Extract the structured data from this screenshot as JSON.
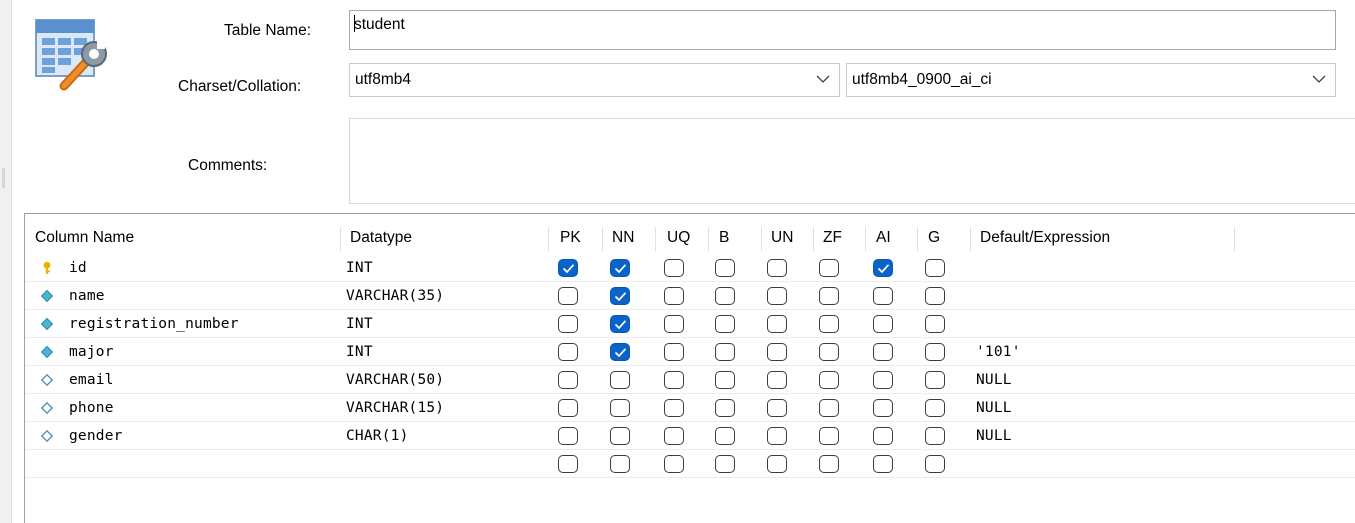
{
  "form": {
    "table_name_label": "Table Name:",
    "table_name_value": "student",
    "charset_label": "Charset/Collation:",
    "charset_value": "utf8mb4",
    "collation_value": "utf8mb4_0900_ai_ci",
    "comments_label": "Comments:",
    "comments_value": ""
  },
  "grid": {
    "headers": [
      "Column Name",
      "Datatype",
      "PK",
      "NN",
      "UQ",
      "B",
      "UN",
      "ZF",
      "AI",
      "G",
      "Default/Expression"
    ],
    "rows": [
      {
        "icon": "key-icon",
        "name": "id",
        "datatype": "INT",
        "pk": true,
        "nn": true,
        "uq": false,
        "b": false,
        "un": false,
        "zf": false,
        "ai": true,
        "g": false,
        "default": ""
      },
      {
        "icon": "diamond-filled-icon",
        "name": "name",
        "datatype": "VARCHAR(35)",
        "pk": false,
        "nn": true,
        "uq": false,
        "b": false,
        "un": false,
        "zf": false,
        "ai": false,
        "g": false,
        "default": ""
      },
      {
        "icon": "diamond-filled-icon",
        "name": "registration_number",
        "datatype": "INT",
        "pk": false,
        "nn": true,
        "uq": false,
        "b": false,
        "un": false,
        "zf": false,
        "ai": false,
        "g": false,
        "default": ""
      },
      {
        "icon": "diamond-filled-icon",
        "name": "major",
        "datatype": "INT",
        "pk": false,
        "nn": true,
        "uq": false,
        "b": false,
        "un": false,
        "zf": false,
        "ai": false,
        "g": false,
        "default": "'101'"
      },
      {
        "icon": "diamond-outline-icon",
        "name": "email",
        "datatype": "VARCHAR(50)",
        "pk": false,
        "nn": false,
        "uq": false,
        "b": false,
        "un": false,
        "zf": false,
        "ai": false,
        "g": false,
        "default": "NULL"
      },
      {
        "icon": "diamond-outline-icon",
        "name": "phone",
        "datatype": "VARCHAR(15)",
        "pk": false,
        "nn": false,
        "uq": false,
        "b": false,
        "un": false,
        "zf": false,
        "ai": false,
        "g": false,
        "default": "NULL"
      },
      {
        "icon": "diamond-outline-icon",
        "name": "gender",
        "datatype": "CHAR(1)",
        "pk": false,
        "nn": false,
        "uq": false,
        "b": false,
        "un": false,
        "zf": false,
        "ai": false,
        "g": false,
        "default": "NULL"
      },
      {
        "icon": "",
        "name": "",
        "datatype": "",
        "pk": false,
        "nn": false,
        "uq": false,
        "b": false,
        "un": false,
        "zf": false,
        "ai": false,
        "g": false,
        "default": ""
      }
    ]
  },
  "colors": {
    "checked": "#0a63c9",
    "key": "#e8b400",
    "diamond_filled": "#4bb6d1",
    "diamond_outline": "#4a8fb4"
  }
}
